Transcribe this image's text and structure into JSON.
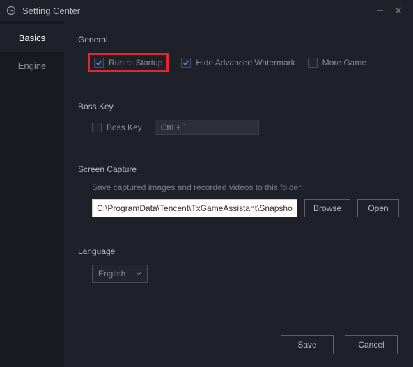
{
  "window": {
    "title": "Setting Center"
  },
  "sidebar": {
    "tabs": [
      {
        "label": "Basics",
        "active": true
      },
      {
        "label": "Engine",
        "active": false
      }
    ]
  },
  "sections": {
    "general": {
      "title": "General",
      "run_at_startup": {
        "label": "Run at Startup",
        "checked": true
      },
      "hide_watermark": {
        "label": "Hide Advanced Watermark",
        "checked": true
      },
      "more_game": {
        "label": "More Game",
        "checked": false
      }
    },
    "boss_key": {
      "title": "Boss Key",
      "enable": {
        "label": "Boss Key",
        "checked": false
      },
      "shortcut_value": "Ctrl + `"
    },
    "screen_capture": {
      "title": "Screen Capture",
      "help": "Save captured images and recorded videos to this folder:",
      "path": "C:\\ProgramData\\Tencent\\TxGameAssistant\\Snapshot",
      "browse": "Browse",
      "open": "Open"
    },
    "language": {
      "title": "Language",
      "selected": "English"
    }
  },
  "footer": {
    "save": "Save",
    "cancel": "Cancel"
  }
}
